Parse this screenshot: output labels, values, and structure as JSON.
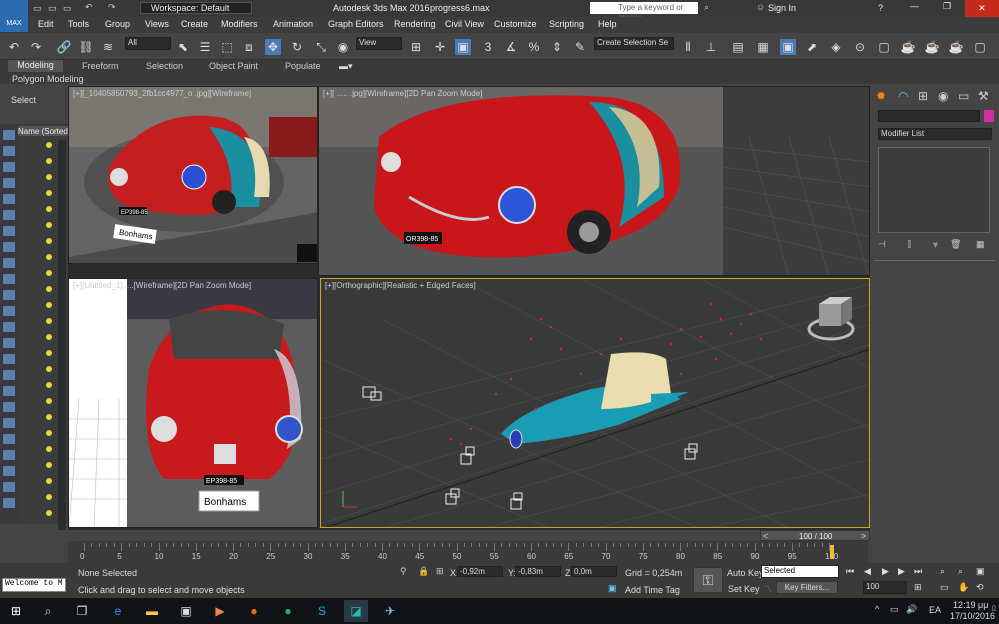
{
  "titlebar": {
    "workspace": "Workspace: Default",
    "app": "Autodesk 3ds Max 2016",
    "file": "progress6.max",
    "search_placeholder": "Type a keyword or phrase",
    "sign_in": "Sign In",
    "help": "?"
  },
  "menu": [
    "Edit",
    "Tools",
    "Group",
    "Views",
    "Create",
    "Modifiers",
    "Animation",
    "Graph Editors",
    "Rendering",
    "Civil View",
    "Customize",
    "Scripting",
    "Help"
  ],
  "toolbar": {
    "filter": "All",
    "refcoord": "View",
    "selection_set": "Create Selection Se"
  },
  "ribbon": {
    "tabs": [
      "Modeling",
      "Freeform",
      "Selection",
      "Object Paint",
      "Populate"
    ],
    "sub": "Polygon Modeling"
  },
  "left": {
    "select": "Select",
    "name_header": "Name (Sorted"
  },
  "viewports": {
    "tl": "[+][_10405850793_2fb1cc4977_o .jpg][Wireframe]",
    "tr": "[+][ ..... .jpg][Wireframe][2D Pan Zoom Mode]",
    "bl": "[+][Untitled_1].....[Wireframe][2D Pan Zoom Mode]",
    "br": "[+][Orthographic][Realistic + Edged Faces]",
    "plate_tl": "Bonhams",
    "plate_bl": "Bonhams",
    "lic_tr": "OR398-85",
    "lic_bl": "EP398-85",
    "lic_tl": "EP398-85"
  },
  "cmd": {
    "modifier_list": "Modifier List"
  },
  "timeline": {
    "frame": "100 / 100",
    "ticks": [
      "0",
      "5",
      "10",
      "15",
      "20",
      "25",
      "30",
      "35",
      "40",
      "45",
      "50",
      "55",
      "60",
      "65",
      "70",
      "75",
      "80",
      "85",
      "90",
      "95",
      "100"
    ]
  },
  "status": {
    "none_selected": "None Selected",
    "hint": "Click and drag to select and move objects",
    "welcome": "Welcome to M",
    "x_label": "X:",
    "x_value": "-0,92m",
    "y_label": "Y:",
    "y_value": "-0,83m",
    "z_label": "Z:",
    "z_value": "0,0m",
    "grid": "Grid = 0,254m",
    "add_time_tag": "Add Time Tag",
    "auto_key": "Auto Key",
    "set_key": "Set Key",
    "selected": "Selected",
    "key_filters": "Key Filters...",
    "frame_field": "100"
  },
  "taskbar": {
    "lang": "EA",
    "time": "12:19 μμ",
    "date": "17/10/2016"
  }
}
